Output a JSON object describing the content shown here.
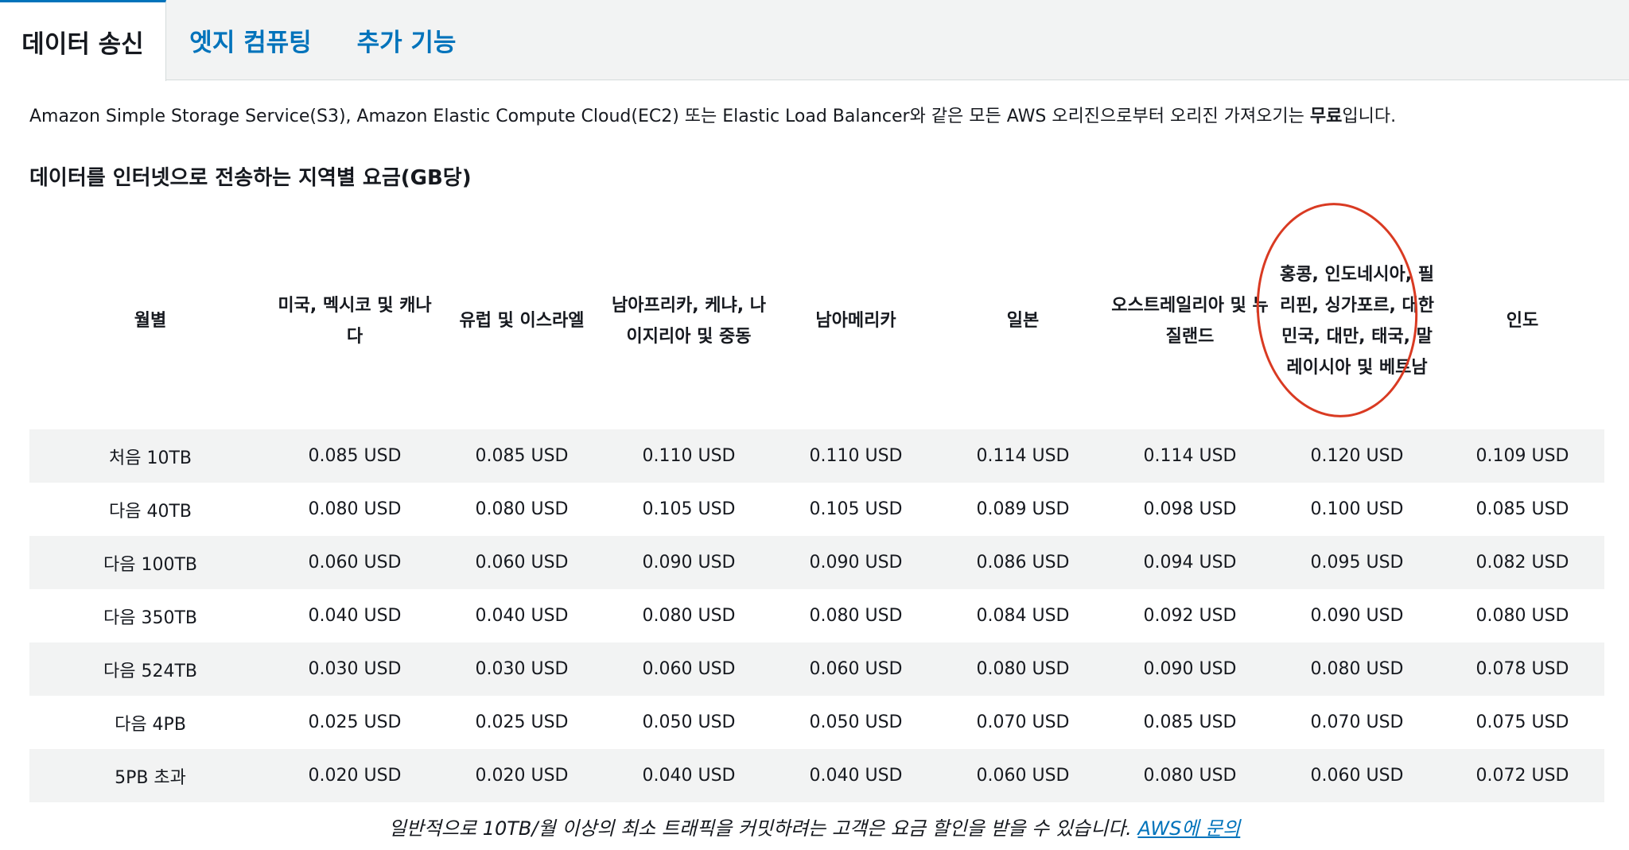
{
  "tabs": [
    {
      "label": "데이터 송신",
      "active": true
    },
    {
      "label": "엣지 컴퓨팅",
      "active": false
    },
    {
      "label": "추가 기능",
      "active": false
    }
  ],
  "intro": {
    "text": "Amazon Simple Storage Service(S3), Amazon Elastic Compute Cloud(EC2) 또는 Elastic Load Balancer와 같은 모든 AWS 오리진으로부터 오리진 가져오기는 ",
    "bold": "무료",
    "suffix": "입니다."
  },
  "section_title": "데이터를 인터넷으로 전송하는 지역별 요금(GB당)",
  "table": {
    "headers": [
      "월별",
      "미국, 멕시코 및 캐나다",
      "유럽 및 이스라엘",
      "남아프리카, 케냐, 나이지리아 및 중동",
      "남아메리카",
      "일본",
      "오스트레일리아 및 뉴질랜드",
      "홍콩, 인도네시아, 필리핀, 싱가포르, 대한민국, 대만, 태국, 말레이시아 및 베트남",
      "인도"
    ],
    "rows": [
      [
        "처음 10TB",
        "0.085 USD",
        "0.085 USD",
        "0.110 USD",
        "0.110 USD",
        "0.114 USD",
        "0.114 USD",
        "0.120 USD",
        "0.109 USD"
      ],
      [
        "다음 40TB",
        "0.080 USD",
        "0.080 USD",
        "0.105 USD",
        "0.105 USD",
        "0.089 USD",
        "0.098 USD",
        "0.100 USD",
        "0.085 USD"
      ],
      [
        "다음 100TB",
        "0.060 USD",
        "0.060 USD",
        "0.090 USD",
        "0.090 USD",
        "0.086 USD",
        "0.094 USD",
        "0.095 USD",
        "0.082 USD"
      ],
      [
        "다음 350TB",
        "0.040 USD",
        "0.040 USD",
        "0.080 USD",
        "0.080 USD",
        "0.084 USD",
        "0.092 USD",
        "0.090 USD",
        "0.080 USD"
      ],
      [
        "다음 524TB",
        "0.030 USD",
        "0.030 USD",
        "0.060 USD",
        "0.060 USD",
        "0.080 USD",
        "0.090 USD",
        "0.080 USD",
        "0.078 USD"
      ],
      [
        "다음 4PB",
        "0.025 USD",
        "0.025 USD",
        "0.050 USD",
        "0.050 USD",
        "0.070 USD",
        "0.085 USD",
        "0.070 USD",
        "0.075 USD"
      ],
      [
        "5PB 초과",
        "0.020 USD",
        "0.020 USD",
        "0.040 USD",
        "0.040 USD",
        "0.060 USD",
        "0.080 USD",
        "0.060 USD",
        "0.072 USD"
      ]
    ]
  },
  "footnote": {
    "text": "일반적으로 10TB/월 이상의 최소 트래픽을 커밋하려는 고객은 요금 할인을 받을 수 있습니다. ",
    "link": "AWS에 문의"
  },
  "colors": {
    "accent": "#0073bb",
    "annotation_circle": "#d93a22",
    "row_shade": "#f2f3f3"
  }
}
